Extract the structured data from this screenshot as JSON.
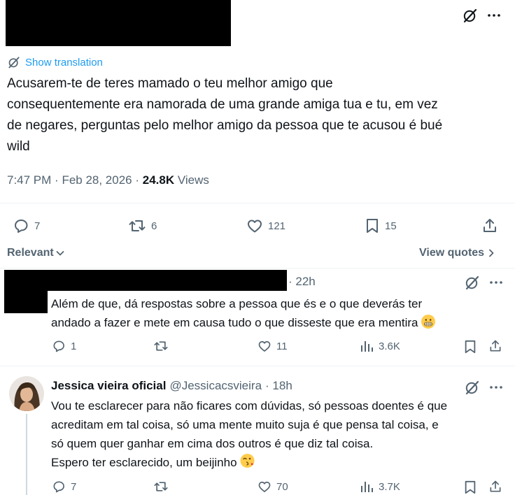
{
  "main_tweet": {
    "show_translation": "Show translation",
    "text": "Acusarem-te de teres mamado o teu melhor amigo que consequentemente era namorada de uma grande amiga tua e tu, em vez de negares, perguntas pelo melhor amigo da pessoa que te acusou é bué wild",
    "line1": "Acusarem-te de teres mamado o teu melhor amigo que",
    "line2": "consequentemente era namorada de uma grande amiga tua e tu, em vez",
    "line3": "de negares, perguntas pelo melhor amigo da pessoa que te acusou é bué",
    "line4": "wild",
    "time": "7:47 PM",
    "date": "Feb 28, 2026",
    "views_count": "24.8K",
    "views_label": "Views",
    "replies": "7",
    "reposts": "6",
    "likes": "121",
    "bookmarks": "15"
  },
  "sort": {
    "label": "Relevant",
    "view_quotes": "View quotes"
  },
  "reply1": {
    "time": "· 22h",
    "line1": "Além de que, dá respostas sobre a pessoa que és e o que deverás ter",
    "line2": "andado a fazer e mete em causa tudo o que disseste que era mentira",
    "replies": "1",
    "reposts": "",
    "likes": "11",
    "views": "3.6K"
  },
  "reply2": {
    "name": "Jessica vieira oficial",
    "handle": "@Jessicacsvieira",
    "time": "· 18h",
    "line1": "Vou te esclarecer para não ficares com dúvidas, só pessoas doentes é que",
    "line2": "acreditam em tal coisa, só uma mente muito suja é que pensa tal coisa, e",
    "line3": "só quem quer ganhar em cima dos outros é que diz tal coisa.",
    "line4": "Espero ter esclarecido, um beijinho",
    "replies": "7",
    "reposts": "",
    "likes": "70",
    "views": "3.7K"
  },
  "icons": {
    "grok": "grok-icon",
    "more": "more-icon",
    "translate": "translate-icon",
    "reply": "reply-icon",
    "repost": "repost-icon",
    "like": "like-icon",
    "bookmark": "bookmark-icon",
    "share": "share-icon",
    "views": "views-icon",
    "grimace_emoji": "grimacing-face-emoji",
    "kiss_emoji": "face-blowing-kiss-emoji"
  },
  "colors": {
    "link": "#1d9bf0",
    "muted": "#536471",
    "text": "#0f1419",
    "divider": "#eff3f4",
    "thread_line": "#cfd9de"
  }
}
